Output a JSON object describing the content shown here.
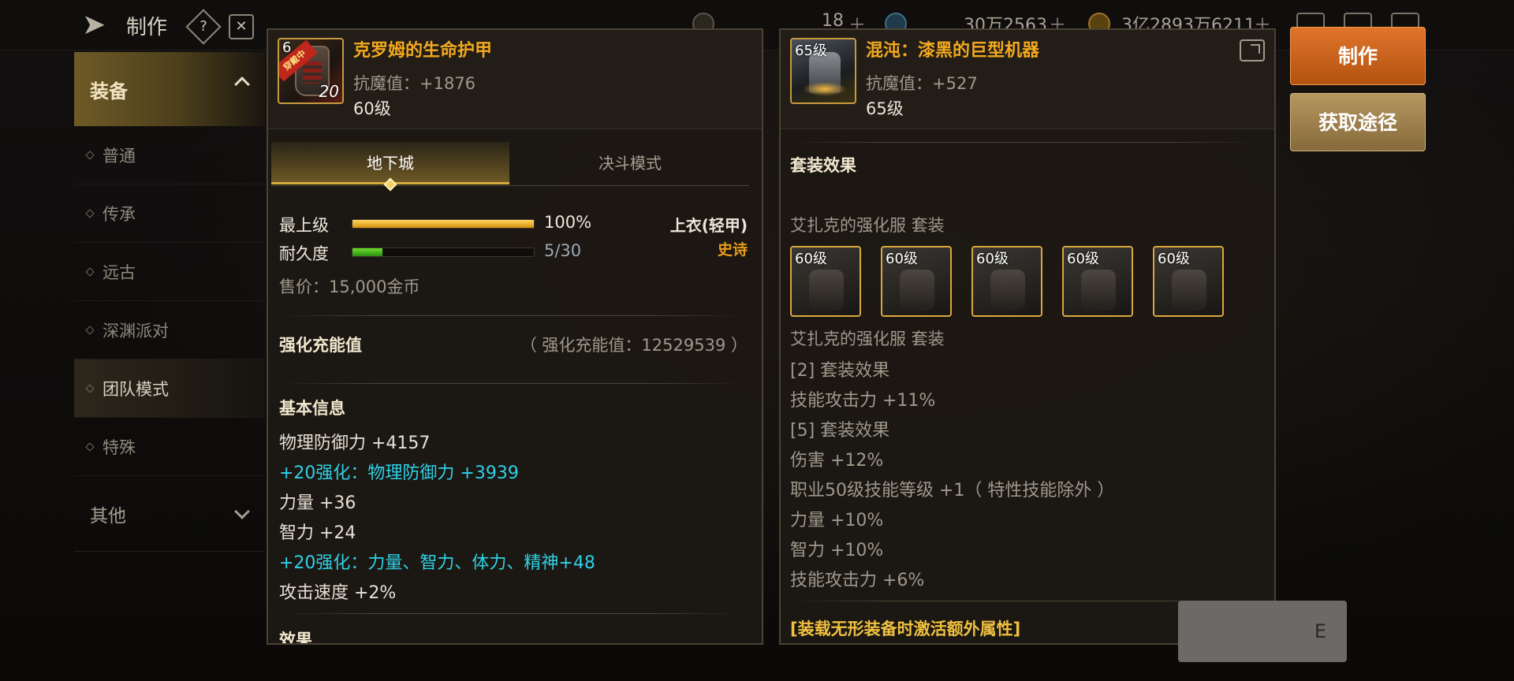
{
  "topbar": {
    "title": "制作",
    "currency_1": "18",
    "currency_2": "30万2563",
    "currency_3": "3亿2893万6211"
  },
  "sidebar": {
    "header": "装备",
    "items": [
      {
        "label": "普通"
      },
      {
        "label": "传承"
      },
      {
        "label": "远古"
      },
      {
        "label": "深渊派对"
      },
      {
        "label": "团队模式"
      },
      {
        "label": "特殊"
      }
    ],
    "other": "其他"
  },
  "left_panel": {
    "item_name": "克罗姆的生命护甲",
    "equipped_tag": "穿戴中",
    "corner_level": "6",
    "enhance_badge": "20",
    "stat": "抗魔值：+1876",
    "level": "60级",
    "tabs": [
      "地下城",
      "决斗模式"
    ],
    "grade_label": "最上级",
    "grade_pct": "100%",
    "grade_fraction": 1.0,
    "durability_label": "耐久度",
    "durability_text": "5/30",
    "durability_fraction": 0.1667,
    "slot": "上衣(轻甲)",
    "rarity": "史诗",
    "sell_price": "售价：15,000金币",
    "enhance_energy_title": "强化充能值",
    "enhance_energy_value": "（ 强化充能值：12529539 ）",
    "basic_info_title": "基本信息",
    "stats": [
      {
        "text": "物理防御力 +4157",
        "cyan": false
      },
      {
        "text": "+20强化：物理防御力 +3939",
        "cyan": true
      },
      {
        "text": "力量 +36",
        "cyan": false
      },
      {
        "text": "智力 +24",
        "cyan": false
      },
      {
        "text": "+20强化：力量、智力、体力、精神+48",
        "cyan": true
      },
      {
        "text": "攻击速度 +2%",
        "cyan": false
      }
    ],
    "effect_title": "效果"
  },
  "right_panel": {
    "item_name": "混沌：漆黑的巨型机器",
    "corner_level": "65级",
    "stat": "抗魔值：+527",
    "level": "65级",
    "set_effect_title": "套装效果",
    "set_name_1": "艾扎克的强化服  套装",
    "set_pieces": [
      {
        "level": "60级"
      },
      {
        "level": "60级"
      },
      {
        "level": "60级"
      },
      {
        "level": "60级"
      },
      {
        "level": "60级"
      }
    ],
    "set_name_2": "艾扎克的强化服  套装",
    "set_lines": [
      "[2] 套装效果",
      "技能攻击力 +11%",
      "[5] 套装效果",
      "伤害 +12%",
      "职业50级技能等级 +1（ 特性技能除外 ）",
      "力量 +10%",
      "智力 +10%",
      "技能攻击力 +6%"
    ],
    "extra_attr": "[装载无形装备时激活额外属性]"
  },
  "buttons": {
    "craft": "制作",
    "obtain": "获取途径",
    "ghost": "E"
  },
  "colors": {
    "item_name": "#f2a91e",
    "cyan_stat": "#2fd1e6",
    "rarity_epic": "#e79a1d",
    "craft_button": "#d0661f",
    "obtain_button": "#a0834e"
  }
}
